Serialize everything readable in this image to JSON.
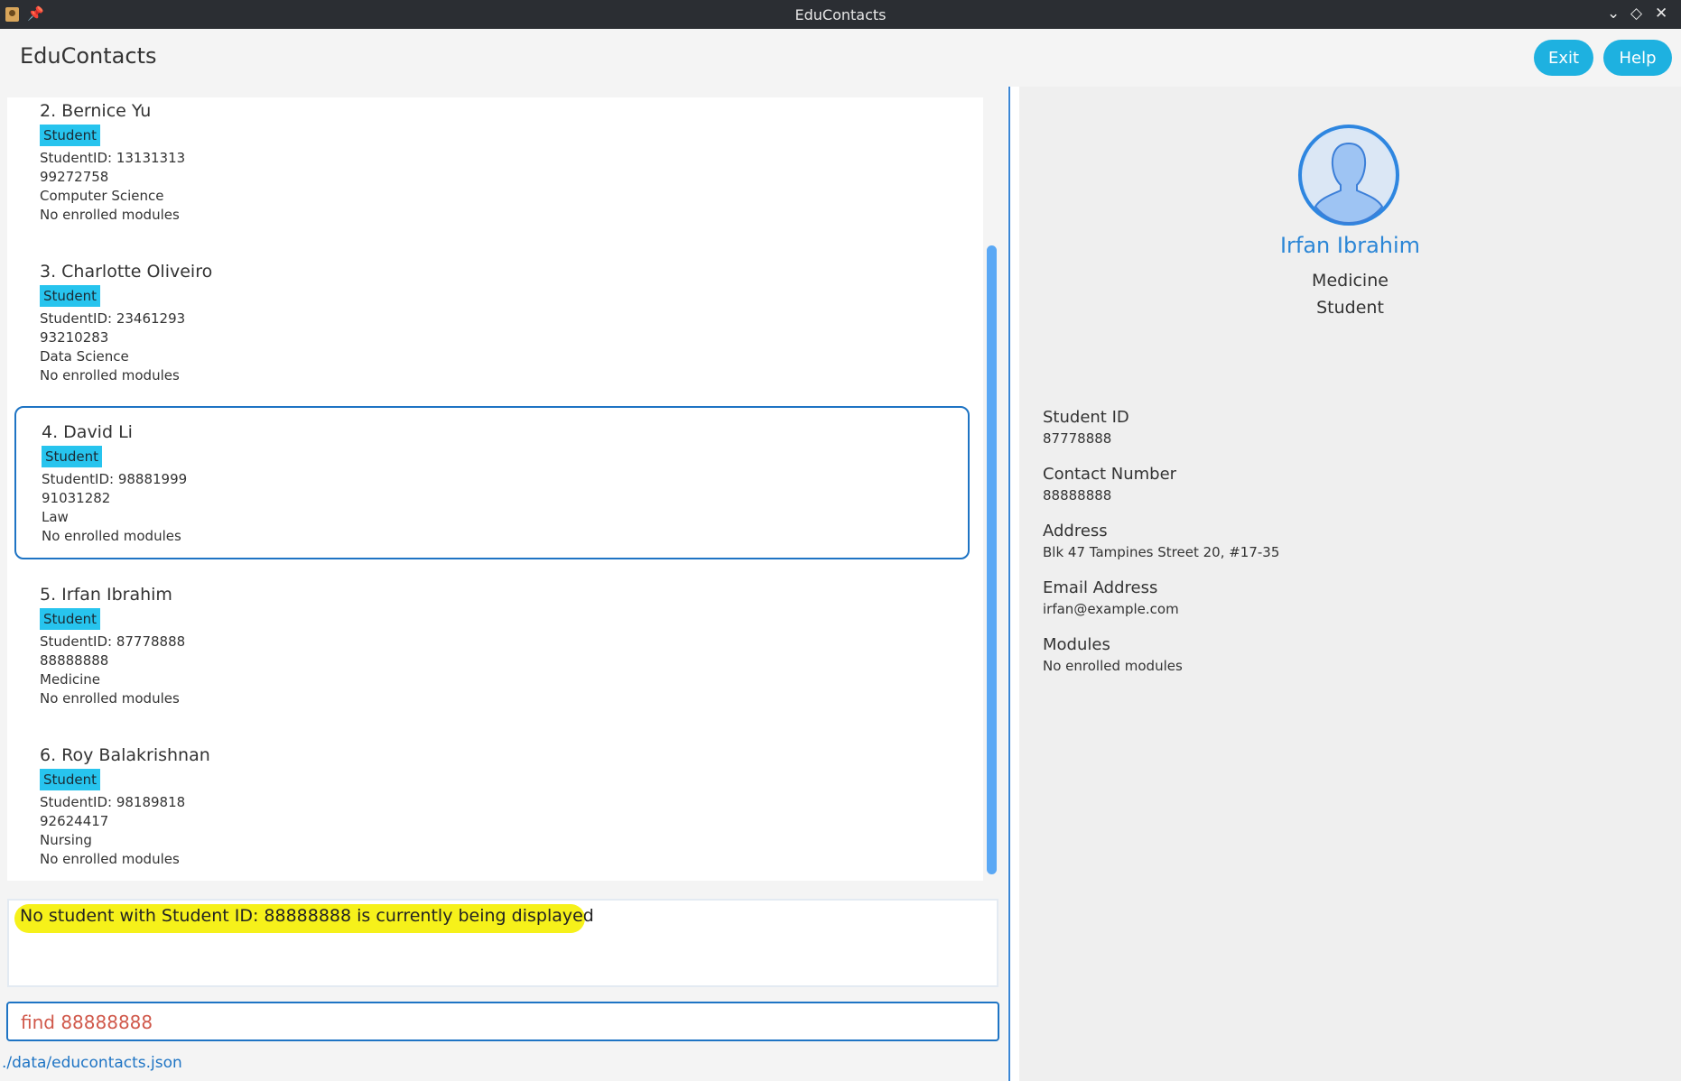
{
  "window": {
    "title": "EduContacts",
    "icons": [
      "app-icon",
      "pin-icon",
      "minimize-icon",
      "maximize-icon",
      "close-icon"
    ]
  },
  "header": {
    "app_name": "EduContacts",
    "exit_label": "Exit",
    "help_label": "Help"
  },
  "list": [
    {
      "name": "2. Bernice Yu",
      "tag": "Student",
      "student_id": "StudentID: 13131313",
      "phone": "99272758",
      "course": "Computer Science",
      "modules": "No enrolled modules"
    },
    {
      "name": "3. Charlotte Oliveiro",
      "tag": "Student",
      "student_id": "StudentID: 23461293",
      "phone": "93210283",
      "course": "Data Science",
      "modules": "No enrolled modules"
    },
    {
      "name": "4. David Li",
      "tag": "Student",
      "student_id": "StudentID: 98881999",
      "phone": "91031282",
      "course": "Law",
      "modules": "No enrolled modules"
    },
    {
      "name": "5. Irfan Ibrahim",
      "tag": "Student",
      "student_id": "StudentID: 87778888",
      "phone": "88888888",
      "course": "Medicine",
      "modules": "No enrolled modules"
    },
    {
      "name": "6. Roy Balakrishnan",
      "tag": "Student",
      "student_id": "StudentID: 98189818",
      "phone": "92624417",
      "course": "Nursing",
      "modules": "No enrolled modules"
    }
  ],
  "result": {
    "message": "No student with Student ID: 88888888 is currently being displayed"
  },
  "command": {
    "value": "find 88888888"
  },
  "status": {
    "path": "./data/educontacts.json"
  },
  "detail": {
    "name": "Irfan Ibrahim",
    "course": "Medicine",
    "role": "Student",
    "student_id_label": "Student ID",
    "student_id": "87778888",
    "contact_label": "Contact Number",
    "contact": "88888888",
    "address_label": "Address",
    "address": "Blk 47 Tampines Street 20, #17-35",
    "email_label": "Email Address",
    "email": "irfan@example.com",
    "modules_label": "Modules",
    "modules": "No enrolled modules"
  },
  "colors": {
    "accent": "#1eb1e0",
    "selection_border": "#1e74c4",
    "tag": "#27c4ee",
    "highlight": "#f6f11a",
    "command_text": "#d0584a"
  }
}
